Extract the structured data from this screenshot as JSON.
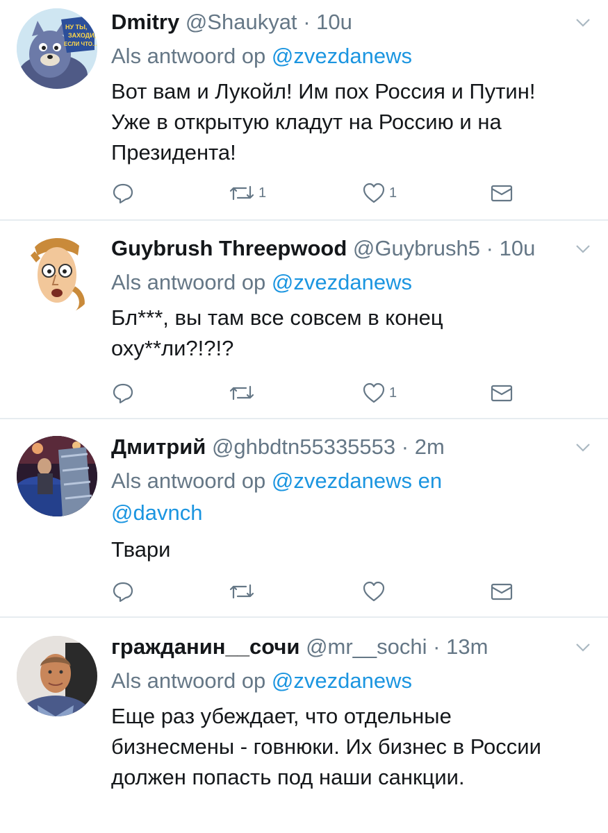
{
  "tweets": [
    {
      "name": "Dmitry",
      "handle": "@Shaukyat",
      "dot": "·",
      "time": "10u",
      "reply_prefix": "Als antwoord op ",
      "mentions": [
        "@zvezdanews"
      ],
      "mention_join": "",
      "text": "Вот вам и Лукойл! Им пох Россия и Путин! Уже в открытую кладут на Россию и на Президента!",
      "retweet_count": "1",
      "like_count": "1",
      "avatar_icon": "cat-cartoon-avatar",
      "avatar_caption": [
        "НУ ТЫ,",
        "ЗАХОДИ,",
        "ЕСЛИ ЧТО..."
      ]
    },
    {
      "name": "Guybrush Threepwood",
      "handle": "@Guybrush5",
      "dot": "·",
      "time": "10u",
      "reply_prefix": "Als antwoord op ",
      "mentions": [
        "@zvezdanews"
      ],
      "mention_join": "",
      "text": "Бл***, вы там все совсем в конец оху**ли?!?!?",
      "retweet_count": "",
      "like_count": "1",
      "avatar_icon": "cartoon-man-avatar"
    },
    {
      "name": "Дмитрий",
      "handle": "@ghbdtn55335553",
      "dot": "·",
      "time": "2m",
      "reply_prefix": "Als antwoord op ",
      "mentions": [
        "@zvezdanews",
        "@davnch"
      ],
      "mention_join": " en ",
      "text": "Твари",
      "retweet_count": "",
      "like_count": "",
      "avatar_icon": "casino-photo-avatar"
    },
    {
      "name": "гражданин__сочи",
      "handle": "@mr__sochi",
      "dot": "·",
      "time": "13m",
      "reply_prefix": "Als antwoord op ",
      "mentions": [
        "@zvezdanews"
      ],
      "mention_join": "",
      "text": "Еще раз убеждает, что отдельные бизнесмены - говнюки. Их бизнес в России должен попасть под наши санкции.",
      "retweet_count": "",
      "like_count": "",
      "avatar_icon": "man-portrait-avatar"
    }
  ],
  "colors": {
    "link": "#1b95e0",
    "secondary_text": "#657786",
    "primary_text": "#14171a",
    "divider": "#e6ecf0"
  },
  "icons": {
    "reply": "reply-icon",
    "retweet": "retweet-icon",
    "like": "heart-icon",
    "message": "envelope-icon",
    "menu": "chevron-down-icon"
  }
}
